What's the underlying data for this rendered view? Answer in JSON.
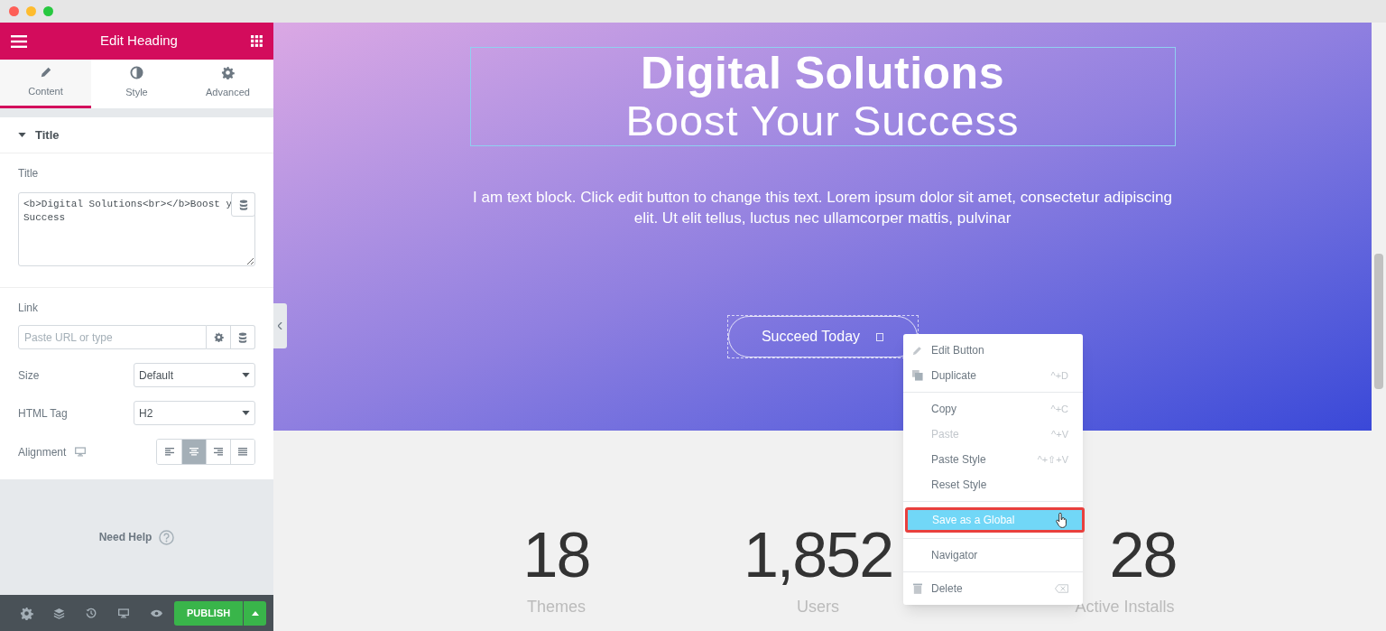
{
  "panel": {
    "title": "Edit Heading",
    "tabs": [
      {
        "label": "Content",
        "selected": true
      },
      {
        "label": "Style",
        "selected": false
      },
      {
        "label": "Advanced",
        "selected": false
      }
    ],
    "section": {
      "title": "Title",
      "expanded": true
    },
    "title_field": {
      "label": "Title",
      "value": "<b>Digital Solutions<br></b>Boost y\nSuccess"
    },
    "link_field": {
      "label": "Link",
      "placeholder": "Paste URL or type"
    },
    "size": {
      "label": "Size",
      "value": "Default"
    },
    "html_tag": {
      "label": "HTML Tag",
      "value": "H2"
    },
    "alignment": {
      "label": "Alignment",
      "options": [
        {
          "selected": false
        },
        {
          "selected": true
        },
        {
          "selected": false
        },
        {
          "selected": false
        }
      ]
    },
    "help": "Need Help",
    "publish": "PUBLISH"
  },
  "hero": {
    "heading_bold": "Digital Solutions",
    "heading_light": "Boost Your Success",
    "text": "I am text block. Click edit button to change this text. Lorem ipsum dolor sit amet, consectetur adipiscing elit. Ut elit tellus, luctus nec ullamcorper mattis, pulvinar",
    "button": "Succeed Today"
  },
  "stats": [
    {
      "number": "18",
      "label": "Themes"
    },
    {
      "number": "1,852",
      "label": "Users"
    },
    {
      "number": "28",
      "label": "Active Installs"
    }
  ],
  "context_menu": [
    [
      {
        "kind": "edit",
        "label": "Edit Button",
        "disabled": false,
        "selected": false
      },
      {
        "kind": "duplicate",
        "label": "Duplicate",
        "shortcut": "^+D",
        "disabled": false,
        "selected": false
      }
    ],
    [
      {
        "kind": "plain",
        "label": "Copy",
        "shortcut": "^+C",
        "disabled": false,
        "selected": false
      },
      {
        "kind": "plain",
        "label": "Paste",
        "shortcut": "^+V",
        "disabled": true,
        "selected": false
      },
      {
        "kind": "plain",
        "label": "Paste Style",
        "shortcut": "^+⇧+V",
        "disabled": false,
        "selected": false
      },
      {
        "kind": "plain",
        "label": "Reset Style",
        "disabled": false,
        "selected": false
      }
    ],
    [
      {
        "kind": "plain",
        "label": "Save as a Global",
        "disabled": false,
        "selected": true
      }
    ],
    [
      {
        "kind": "plain",
        "label": "Navigator",
        "disabled": false,
        "selected": false
      }
    ],
    [
      {
        "kind": "delete",
        "label": "Delete",
        "disabled": false,
        "selected": false
      }
    ]
  ]
}
